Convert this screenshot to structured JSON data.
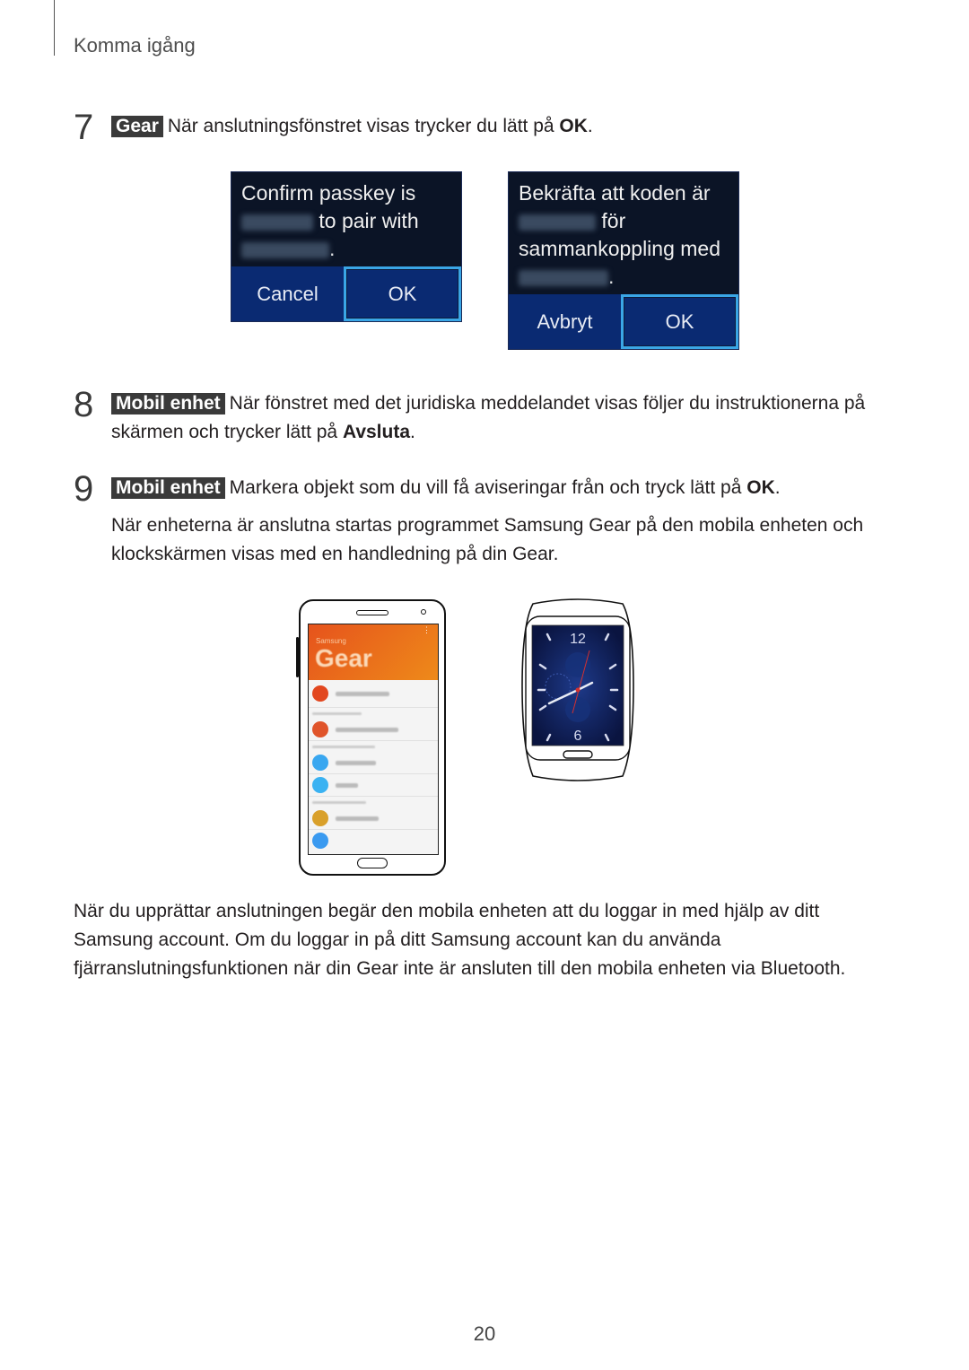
{
  "header": {
    "section_title": "Komma igång"
  },
  "steps": [
    {
      "number": "7",
      "tag": "Gear",
      "text": "När anslutningsfönstret visas trycker du lätt på ",
      "bold": "OK",
      "end": "."
    },
    {
      "number": "8",
      "tag": "Mobil enhet",
      "text": "När fönstret med det juridiska meddelandet visas följer du instruktionerna på skärmen och trycker lätt på ",
      "bold": "Avsluta",
      "end": "."
    },
    {
      "number": "9",
      "tag": "Mobil enhet",
      "text": "Markera objekt som du vill få aviseringar från och tryck lätt på ",
      "bold": "OK",
      "end": ".",
      "note": "När enheterna är anslutna startas programmet Samsung Gear på den mobila enheten och klockskärmen visas med en handledning på din Gear."
    }
  ],
  "dialogs": {
    "english": {
      "line1": "Confirm passkey is",
      "line2": "to pair with",
      "line3": ".",
      "cancel": "Cancel",
      "ok": "OK"
    },
    "swedish": {
      "line1": "Bekräfta att koden är",
      "line2": "för",
      "line3": "sammankoppling med",
      "line4": ".",
      "cancel": "Avbryt",
      "ok": "OK"
    }
  },
  "phone_screen": {
    "brand": "Samsung",
    "app": "Gear"
  },
  "watch": {
    "top_numeral": "12",
    "bottom_numeral": "6"
  },
  "footer_paragraph": "När du upprättar anslutningen begär den mobila enheten att du loggar in med hjälp av ditt Samsung account. Om du loggar in på ditt Samsung account kan du använda fjärranslutningsfunktionen när din Gear inte är ansluten till den mobila enheten via Bluetooth.",
  "page_number": "20"
}
